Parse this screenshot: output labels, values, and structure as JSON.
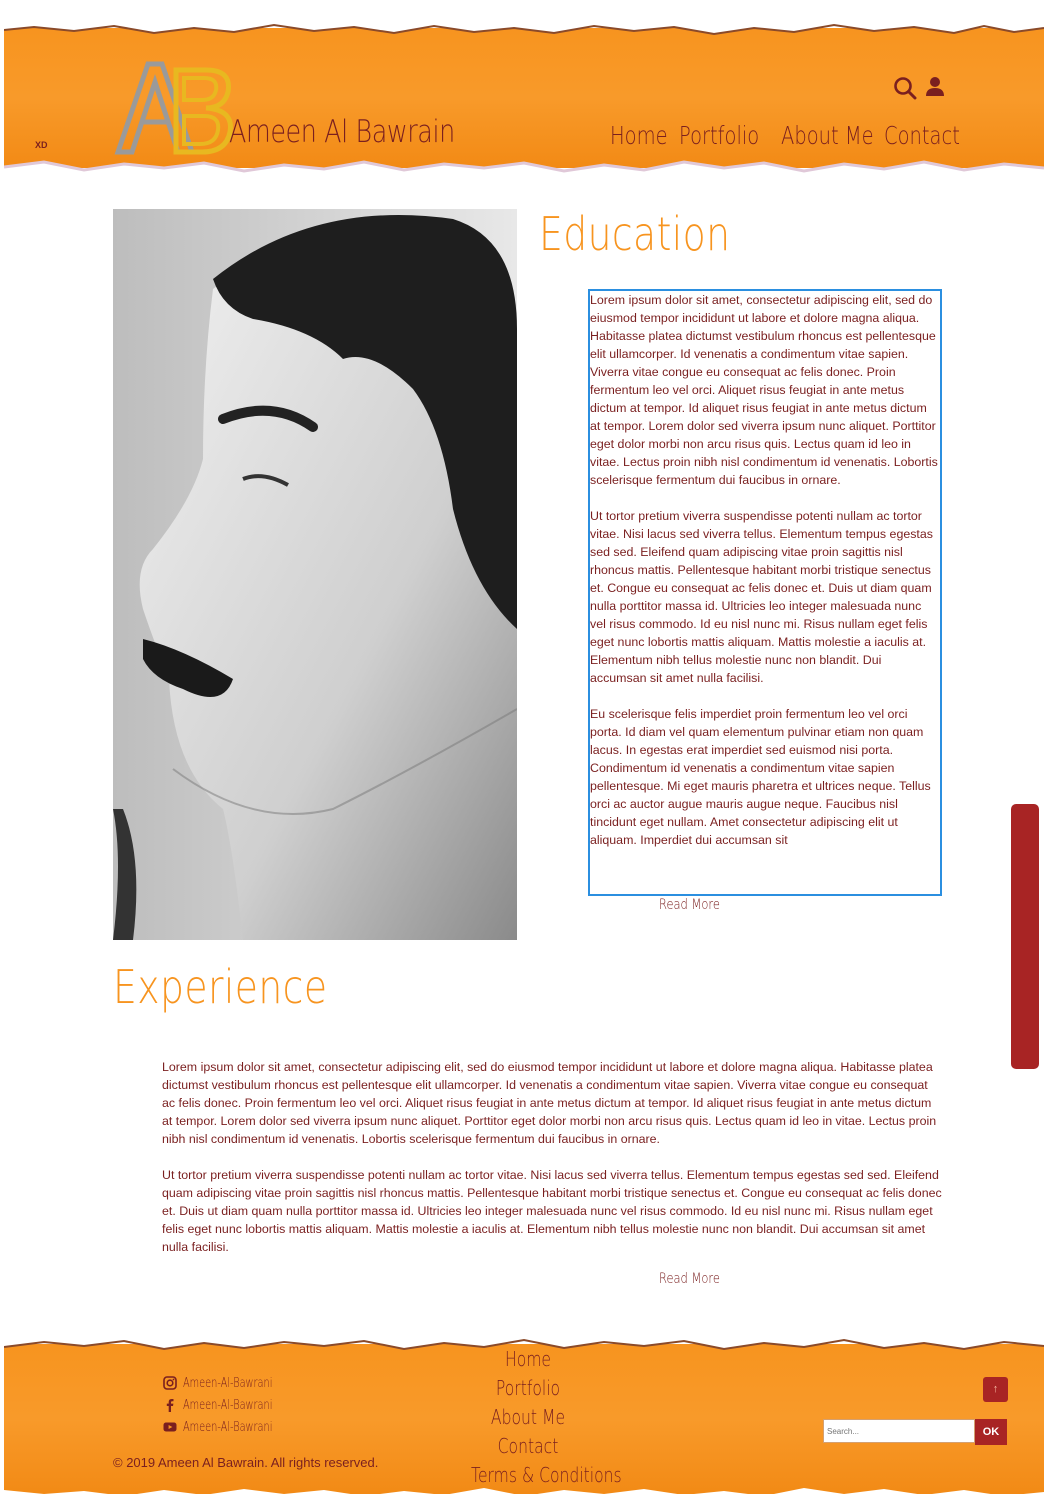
{
  "header": {
    "site_name": "Ameen Al Bawrain",
    "logo_letters": "AB",
    "xd_label": "XD",
    "nav": [
      "Home",
      "Portfolio",
      "About Me",
      "Contact"
    ]
  },
  "education": {
    "title": "Education",
    "paragraphs": [
      "Lorem ipsum dolor sit amet, consectetur adipiscing elit, sed do eiusmod tempor incididunt ut labore et dolore magna aliqua. Habitasse platea dictumst vestibulum rhoncus est pellentesque elit ullamcorper. Id venenatis a condimentum vitae sapien. Viverra vitae congue eu consequat ac felis donec. Proin fermentum leo vel orci. Aliquet risus feugiat in ante metus dictum at tempor. Id aliquet risus feugiat in ante metus dictum at tempor. Lorem dolor sed viverra ipsum nunc aliquet. Porttitor eget dolor morbi non arcu risus quis. Lectus quam id leo in vitae. Lectus proin nibh nisl condimentum id venenatis. Lobortis scelerisque fermentum dui faucibus in ornare.",
      "Ut tortor pretium viverra suspendisse potenti nullam ac tortor vitae. Nisi lacus sed viverra tellus. Elementum tempus egestas sed sed. Eleifend quam adipiscing vitae proin sagittis nisl rhoncus mattis. Pellentesque habitant morbi tristique senectus et. Congue eu consequat ac felis donec et. Duis ut diam quam nulla porttitor massa id. Ultricies leo integer malesuada nunc vel risus commodo. Id eu nisl nunc mi. Risus nullam eget felis eget nunc lobortis mattis aliquam. Mattis molestie a iaculis at. Elementum nibh tellus molestie nunc non blandit. Dui accumsan sit amet nulla facilisi.",
      "Eu scelerisque felis imperdiet proin fermentum leo vel orci porta. Id diam vel quam elementum pulvinar etiam non quam lacus. In egestas erat imperdiet sed euismod nisi porta. Condimentum id venenatis a condimentum vitae sapien pellentesque. Mi eget mauris pharetra et ultrices neque. Tellus orci ac auctor augue mauris augue neque. Faucibus nisl tincidunt eget nullam. Amet consectetur adipiscing elit ut aliquam. Imperdiet dui accumsan sit"
    ],
    "read_more": "Read More"
  },
  "experience": {
    "title": "Experience",
    "paragraphs": [
      "Lorem ipsum dolor sit amet, consectetur adipiscing elit, sed do eiusmod tempor incididunt ut labore et dolore magna aliqua. Habitasse platea dictumst vestibulum rhoncus est pellentesque elit ullamcorper. Id venenatis a condimentum vitae sapien. Viverra vitae congue eu consequat ac felis donec. Proin fermentum leo vel orci. Aliquet risus feugiat in ante metus dictum at tempor. Id aliquet risus feugiat in ante metus dictum at tempor. Lorem dolor sed viverra ipsum nunc aliquet. Porttitor eget dolor morbi non arcu risus quis. Lectus quam id leo in vitae. Lectus proin nibh nisl condimentum id venenatis. Lobortis scelerisque fermentum dui faucibus in ornare.",
      "Ut tortor pretium viverra suspendisse potenti nullam ac tortor vitae. Nisi lacus sed viverra tellus. Elementum tempus egestas sed sed. Eleifend quam adipiscing vitae proin sagittis nisl rhoncus mattis. Pellentesque habitant morbi tristique senectus et. Congue eu consequat ac felis donec et. Duis ut diam quam nulla porttitor massa id. Ultricies leo integer malesuada nunc vel risus commodo. Id eu nisl nunc mi. Risus nullam eget felis eget nunc lobortis mattis aliquam. Mattis molestie a iaculis at. Elementum nibh tellus molestie nunc non blandit. Dui accumsan sit amet nulla facilisi."
    ],
    "read_more": "Read More"
  },
  "footer": {
    "social": [
      {
        "icon": "instagram-icon",
        "handle": "Ameen-Al-Bawrani"
      },
      {
        "icon": "facebook-icon",
        "handle": "Ameen-Al-Bawrani"
      },
      {
        "icon": "youtube-icon",
        "handle": "Ameen-Al-Bawrani"
      }
    ],
    "nav": [
      "Home",
      "Portfolio",
      "About Me",
      "Contact",
      "Terms & Conditions"
    ],
    "copyright": "© 2019 Ameen Al Bawrain. All rights reserved.",
    "search_placeholder": "Search...",
    "search_button": "OK",
    "to_top": "↑"
  },
  "colors": {
    "accent_orange": "#f7941f",
    "text_maroon": "#7a1f1f",
    "button_red": "#a82424",
    "focus_blue": "#2b8fe0"
  }
}
